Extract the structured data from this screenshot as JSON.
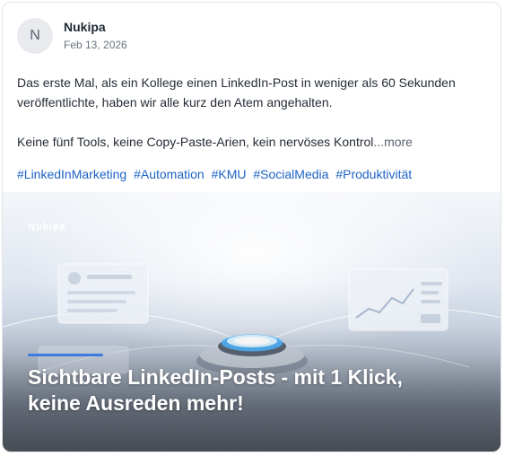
{
  "post": {
    "avatar_initial": "N",
    "author": "Nukipa",
    "date": "Feb 13, 2026",
    "paragraph_1": "Das erste Mal, als ein Kollege einen LinkedIn-Post in weniger als 60 Sekunden veröffentlichte, haben wir alle kurz den Atem angehalten.",
    "paragraph_2": "Keine fünf Tools, keine Copy-Paste-Arien, kein nervöses Kontrol",
    "more_label": "...more",
    "hashtags": [
      "#LinkedInMarketing",
      "#Automation",
      "#KMU",
      "#SocialMedia",
      "#Produktivität"
    ]
  },
  "media": {
    "brand": "Nukipa",
    "headline": "Sichtbare LinkedIn-Posts - mit 1 Klick, keine Ausreden mehr!",
    "accent_color": "#3d7ae0",
    "button_glow_color": "#4fb6ff"
  },
  "colors": {
    "link": "#1d63c5",
    "text": "#252c36",
    "muted": "#6b7380"
  }
}
